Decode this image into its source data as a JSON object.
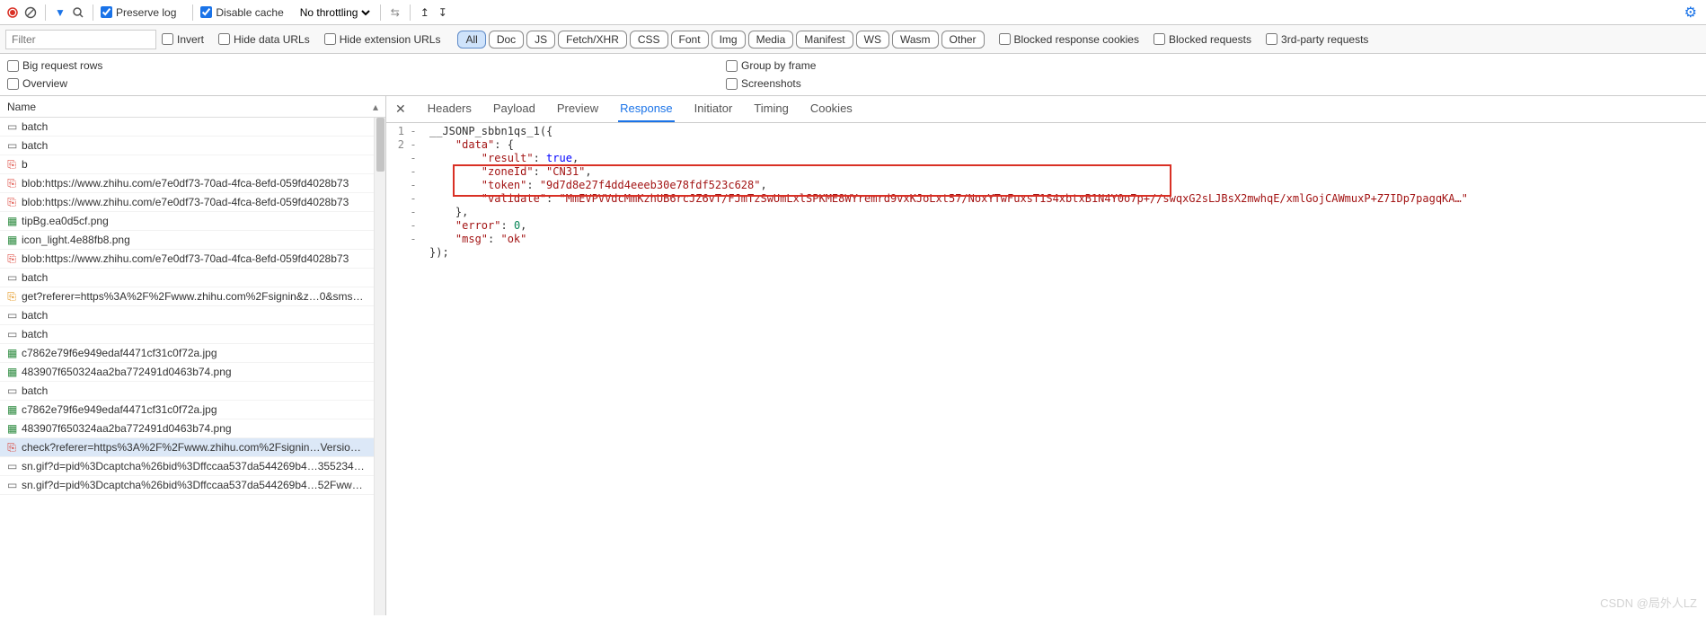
{
  "toolbar": {
    "preserve_log_label": "Preserve log",
    "disable_cache_label": "Disable cache",
    "throttling_label": "No throttling",
    "preserve_log_checked": true,
    "disable_cache_checked": true
  },
  "filterbar": {
    "filter_placeholder": "Filter",
    "invert_label": "Invert",
    "hide_data_urls_label": "Hide data URLs",
    "hide_ext_urls_label": "Hide extension URLs",
    "chips": [
      "All",
      "Doc",
      "JS",
      "Fetch/XHR",
      "CSS",
      "Font",
      "Img",
      "Media",
      "Manifest",
      "WS",
      "Wasm",
      "Other"
    ],
    "active_chip": "All",
    "blocked_cookies_label": "Blocked response cookies",
    "blocked_requests_label": "Blocked requests",
    "third_party_label": "3rd-party requests"
  },
  "options": {
    "big_rows_label": "Big request rows",
    "overview_label": "Overview",
    "group_frame_label": "Group by frame",
    "screenshots_label": "Screenshots"
  },
  "left": {
    "header": "Name",
    "rows": [
      {
        "icon": "doc",
        "label": "batch"
      },
      {
        "icon": "doc",
        "label": "batch"
      },
      {
        "icon": "js-bad",
        "label": "b"
      },
      {
        "icon": "js-bad",
        "label": "blob:https://www.zhihu.com/e7e0df73-70ad-4fca-8efd-059fd4028b73"
      },
      {
        "icon": "js-bad",
        "label": "blob:https://www.zhihu.com/e7e0df73-70ad-4fca-8efd-059fd4028b73"
      },
      {
        "icon": "img",
        "label": "tipBg.ea0d5cf.png"
      },
      {
        "icon": "img",
        "label": "icon_light.4e88fb8.png"
      },
      {
        "icon": "js-bad",
        "label": "blob:https://www.zhihu.com/e7e0df73-70ad-4fca-8efd-059fd4028b73"
      },
      {
        "icon": "doc",
        "label": "batch"
      },
      {
        "icon": "js",
        "label": "get?referer=https%3A%2F%2Fwww.zhihu.com%2Fsignin&z…0&sms…"
      },
      {
        "icon": "doc",
        "label": "batch"
      },
      {
        "icon": "doc",
        "label": "batch"
      },
      {
        "icon": "img",
        "label": "c7862e79f6e949edaf4471cf31c0f72a.jpg"
      },
      {
        "icon": "img",
        "label": "483907f650324aa2ba772491d0463b74.png"
      },
      {
        "icon": "doc",
        "label": "batch"
      },
      {
        "icon": "img",
        "label": "c7862e79f6e949edaf4471cf31c0f72a.jpg"
      },
      {
        "icon": "img",
        "label": "483907f650324aa2ba772491d0463b74.png"
      },
      {
        "icon": "js-bad",
        "label": "check?referer=https%3A%2F%2Fwww.zhihu.com%2Fsignin…Version…",
        "selected": true
      },
      {
        "icon": "doc",
        "label": "sn.gif?d=pid%3Dcaptcha%26bid%3Dffccaa537da544269b4…355234…"
      },
      {
        "icon": "doc",
        "label": "sn.gif?d=pid%3Dcaptcha%26bid%3Dffccaa537da544269b4…52Fww…"
      }
    ]
  },
  "tabs": {
    "items": [
      "Headers",
      "Payload",
      "Preview",
      "Response",
      "Initiator",
      "Timing",
      "Cookies"
    ],
    "active": "Response"
  },
  "response": {
    "fn_open": "__JSONP_sbbn1qs_1({",
    "data_key": "\"data\"",
    "result_key": "\"result\"",
    "result_val": "true",
    "zoneId_key": "\"zoneId\"",
    "zoneId_val": "\"CN31\"",
    "token_key": "\"token\"",
    "token_val": "\"9d7d8e27f4dd4eeeb30e78fdf523c628\"",
    "validate_key": "\"validate\"",
    "validate_val": "\"MmEVPVVdcMmKzhUB6rcJZ6vT/FJmTzSwUmLxlSPKME8WYremrd9vxKJoLxt57/NoxYTwFuxsT1S4xbtxB1N4Y0o7p+//swqxG2sLJBsX2mwhqE/xmlGojCAWmuxP+Z7IDp7pagqKA…\"",
    "error_key": "\"error\"",
    "error_val": "0",
    "msg_key": "\"msg\"",
    "msg_val": "\"ok\"",
    "fn_close": "});"
  },
  "gutter1": [
    "1",
    "",
    "",
    "",
    "",
    "",
    "",
    "",
    "",
    "",
    "2"
  ],
  "gutter2": [
    "",
    "-",
    "-",
    "-",
    "-",
    "-",
    "-",
    "-",
    "-",
    "-",
    ""
  ],
  "watermark": "CSDN @局外人LZ"
}
